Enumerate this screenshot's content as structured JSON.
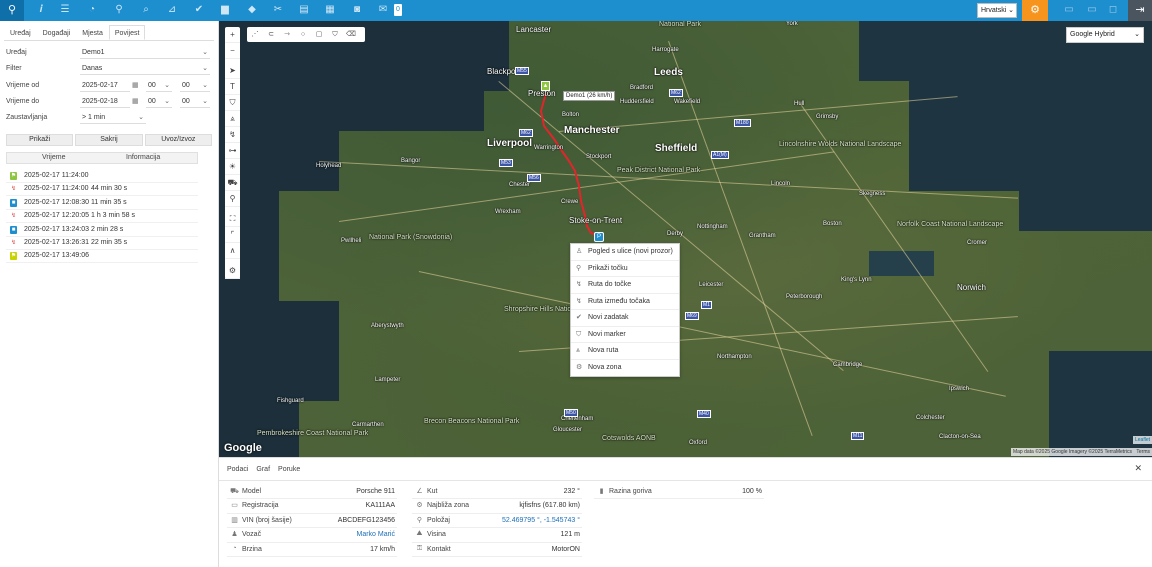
{
  "toolbar": {
    "language": "Hrvatski",
    "badge_count": "0"
  },
  "left_panel": {
    "tabs": [
      "Uređaj",
      "Događaji",
      "Mjesta",
      "Povijest"
    ],
    "active_tab": "Povijest",
    "form": {
      "device_label": "Uređaj",
      "device_value": "Demo1",
      "filter_label": "Filter",
      "filter_value": "Danas",
      "time_from_label": "Vrijeme od",
      "time_from_date": "2025-02-17",
      "time_from_hour": "00",
      "time_from_min": "00",
      "time_to_label": "Vrijeme do",
      "time_to_date": "2025-02-18",
      "time_to_hour": "00",
      "time_to_min": "00",
      "stops_label": "Zaustavljanja",
      "stops_value": "> 1 min"
    },
    "buttons": {
      "show": "Prikaži",
      "hide": "Sakrij",
      "import_export": "Uvoz/Izvoz"
    },
    "events_header": {
      "time": "Vrijeme",
      "info": "Informacija"
    },
    "events": [
      {
        "time": "2025-02-17 11:24:00",
        "info": "",
        "icon": "start-flag-icon",
        "color": "#8dc63f"
      },
      {
        "time": "2025-02-17 11:24:00",
        "info": "44 min 30 s",
        "icon": "route-icon",
        "color": "#d9534f"
      },
      {
        "time": "2025-02-17 12:08:30",
        "info": "11 min 35 s",
        "icon": "stop-icon",
        "color": "#1d8fcf"
      },
      {
        "time": "2025-02-17 12:20:05",
        "info": "1 h 3 min 58 s",
        "icon": "route-icon",
        "color": "#d9534f"
      },
      {
        "time": "2025-02-17 13:24:03",
        "info": "2 min 28 s",
        "icon": "stop-icon",
        "color": "#1d8fcf"
      },
      {
        "time": "2025-02-17 13:26:31",
        "info": "22 min 35 s",
        "icon": "route-icon",
        "color": "#d9534f"
      },
      {
        "time": "2025-02-17 13:49:06",
        "info": "",
        "icon": "end-flag-icon",
        "color": "#c8d400"
      }
    ]
  },
  "map": {
    "layer": "Google Hybrid",
    "tooltip": "Demo1 (26 km/h)",
    "marker_p": "P",
    "context_menu": [
      {
        "icon": "street-view-icon",
        "label": "Pogled s ulice (novi prozor)"
      },
      {
        "icon": "marker-icon",
        "label": "Prikaži točku"
      },
      {
        "icon": "route-icon",
        "label": "Ruta do točke"
      },
      {
        "icon": "route-icon",
        "label": "Ruta između točaka"
      },
      {
        "icon": "check-icon",
        "label": "Novi zadatak"
      },
      {
        "icon": "shield-marker-icon",
        "label": "Novi marker"
      },
      {
        "icon": "road-icon",
        "label": "Nova ruta"
      },
      {
        "icon": "zone-icon",
        "label": "Nova zona"
      }
    ],
    "labels": {
      "national_park": "National Park",
      "lancaster": "Lancaster",
      "harrogate": "Harrogate",
      "blackpool": "Blackpool",
      "preston": "Preston",
      "leeds": "Leeds",
      "bradford": "Bradford",
      "huddersfield": "Huddersfield",
      "wakefield": "Wakefield",
      "bolton": "Bolton",
      "manchester": "Manchester",
      "liverpool": "Liverpool",
      "sheffield": "Sheffield",
      "warrington": "Warrington",
      "stockport": "Stockport",
      "peak_district": "Peak District National Park",
      "chester": "Chester",
      "crewe": "Crewe",
      "stoke": "Stoke-on-Trent",
      "wrexham": "Wrexham",
      "snowdonia": "National Park (Snowdonia)",
      "pwllheli": "Pwllheli",
      "derby": "Derby",
      "nottingham": "Nottingham",
      "lincoln": "Lincoln",
      "grantham": "Grantham",
      "boston": "Boston",
      "norfolk": "Norfolk Coast National Landscape",
      "leicester": "Leicester",
      "peterborough": "Peterborough",
      "kings_lynn": "King's Lynn",
      "norwich": "Norwich",
      "shropshire": "Shropshire Hills National Landscape",
      "aberystwyth": "Aberystwyth",
      "northampton": "Northampton",
      "cambridge": "Cambridge",
      "ipswich": "Ipswich",
      "lampeter": "Lampeter",
      "cheltenham": "Cheltenham",
      "gloucester": "Gloucester",
      "oxford": "Oxford",
      "colchester": "Colchester",
      "fishguard": "Fishguard",
      "carmarthen": "Carmarthen",
      "brecon": "Brecon Beacons National Park",
      "pembrokeshire": "Pembrokeshire Coast National Park",
      "cotswolds": "Cotswolds AONB",
      "clacton": "Clacton-on-Sea",
      "lincolnshire": "Lincolnshire Wolds National Landscape",
      "hull": "Hull",
      "grimsby": "Grimsby",
      "skegness": "Skegness",
      "york": "York",
      "holyhead": "Holyhead",
      "bangor": "Bangor",
      "cromer": "Cromer"
    },
    "google": "Google",
    "attribution": "Map data ©2025 Google Imagery ©2025 TerraMetrics",
    "terms": "Terms",
    "leaflet": "Leaflet"
  },
  "bottom_panel": {
    "tabs": [
      "Podaci",
      "Graf",
      "Poruke"
    ],
    "col1": [
      {
        "icon": "car-icon",
        "label": "Model",
        "value": "Porsche 911"
      },
      {
        "icon": "plate-icon",
        "label": "Registracija",
        "value": "KA111AA"
      },
      {
        "icon": "barcode-icon",
        "label": "VIN (broj šasije)",
        "value": "ABCDEFG123456"
      },
      {
        "icon": "user-icon",
        "label": "Vozač",
        "value": "Marko Marić",
        "link": true
      },
      {
        "icon": "speed-icon",
        "label": "Brzina",
        "value": "17 km/h"
      }
    ],
    "col2": [
      {
        "icon": "angle-icon",
        "label": "Kut",
        "value": "232 °"
      },
      {
        "icon": "zone-icon",
        "label": "Najbliža zona",
        "value": "kjfisfns (617.80 km)"
      },
      {
        "icon": "marker-icon",
        "label": "Položaj",
        "value": "52.469795 °, -1.545743 °",
        "link": true
      },
      {
        "icon": "altitude-icon",
        "label": "Visina",
        "value": "121 m"
      },
      {
        "icon": "key-icon",
        "label": "Kontakt",
        "value": "MotorON"
      }
    ],
    "col3": [
      {
        "icon": "fuel-icon",
        "label": "Razina goriva",
        "value": "100 %"
      }
    ]
  }
}
